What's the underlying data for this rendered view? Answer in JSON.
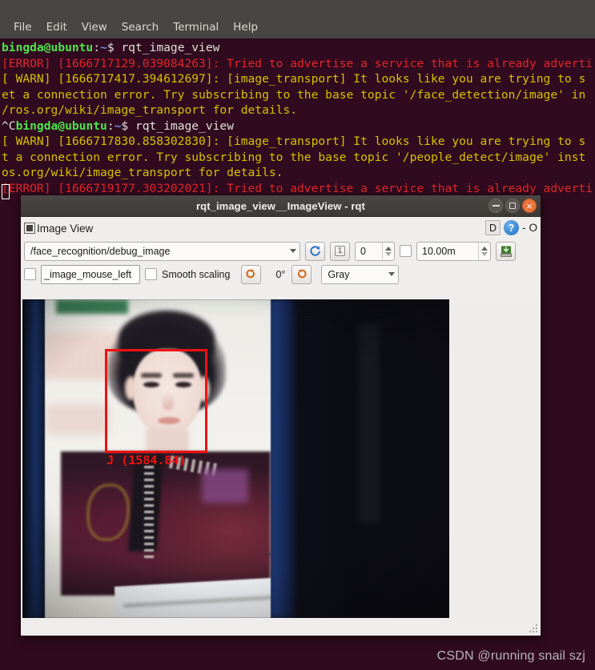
{
  "terminal": {
    "menubar": [
      "File",
      "Edit",
      "View",
      "Search",
      "Terminal",
      "Help"
    ],
    "lines": [
      [
        {
          "t": "bingda@ubuntu",
          "c": "c-green"
        },
        {
          "t": ":",
          "c": "c-white"
        },
        {
          "t": "~",
          "c": "c-blue"
        },
        {
          "t": "$ rqt_image_view",
          "c": "c-white"
        }
      ],
      [
        {
          "t": "[ERROR] [1666717129.039084263]: Tried to advertise a service that is already adverti",
          "c": "c-red"
        }
      ],
      [
        {
          "t": "[ WARN] [1666717417.394612697]: [image_transport] It looks like you are trying to s",
          "c": "c-yellow"
        }
      ],
      [
        {
          "t": "et a connection error. Try subscribing to the base topic '/face_detection/image' in",
          "c": "c-yellow"
        }
      ],
      [
        {
          "t": "/ros.org/wiki/image_transport for details.",
          "c": "c-yellow"
        }
      ],
      [
        {
          "t": "^C",
          "c": "c-white"
        },
        {
          "t": "bingda@ubuntu",
          "c": "c-green"
        },
        {
          "t": ":",
          "c": "c-white"
        },
        {
          "t": "~",
          "c": "c-blue"
        },
        {
          "t": "$ rqt_image_view",
          "c": "c-white"
        }
      ],
      [
        {
          "t": "[ WARN] [1666717830.858302830]: [image_transport] It looks like you are trying to s",
          "c": "c-yellow"
        }
      ],
      [
        {
          "t": "t a connection error. Try subscribing to the base topic '/people_detect/image' inst",
          "c": "c-yellow"
        }
      ],
      [
        {
          "t": "os.org/wiki/image_transport for details.",
          "c": "c-yellow"
        }
      ],
      [
        {
          "t": "[ERROR] [1666719177.303202021]: Tried to advertise a service that is already adverti",
          "c": "c-red"
        }
      ]
    ]
  },
  "watermark": "CSDN @running snail szj",
  "window": {
    "title": "rqt_image_view__ImageView - rqt",
    "buttons": {
      "minimize": "minimize",
      "maximize": "maximize",
      "close": "×"
    }
  },
  "dock": {
    "title": "Image View",
    "float_label": "D",
    "help_label": "?",
    "dash_label": "-",
    "close_label": "O"
  },
  "toolbar_top": {
    "topic": "/face_recognition/debug_image",
    "refresh_icon": "refresh-icon",
    "numbered_button": "1",
    "publish_value": "0",
    "max_checkbox_checked": false,
    "max_value": "10.00m",
    "save_icon": "save-icon"
  },
  "toolbar_bottom": {
    "mouse_topic_checked": false,
    "mouse_topic_value": "_image_mouse_left",
    "smooth_scaling_label": "Smooth scaling",
    "smooth_scaling_checked": false,
    "rotate_ccw_icon": "rotate-counterclockwise-icon",
    "rotation_value": "0°",
    "rotate_cw_icon": "rotate-clockwise-icon",
    "colormap": "Gray"
  },
  "detection": {
    "label": "J (1584.84)",
    "box_color": "#ee1111"
  },
  "colors": {
    "terminal_bg": "#300a1e",
    "menubar_bg": "#484643",
    "prompt_green": "#4ee44e",
    "error_red": "#e0262b",
    "warn_yellow": "#d7c200",
    "window_chrome": "#f0eeec",
    "close_orange": "#e8743c"
  }
}
